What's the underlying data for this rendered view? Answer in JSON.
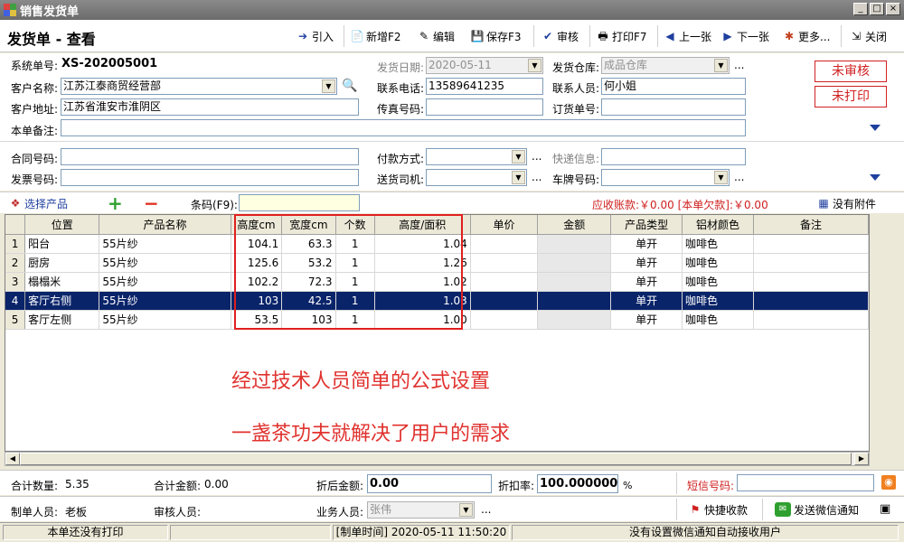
{
  "window": {
    "title": "销售发货单",
    "min": "_",
    "max": "□",
    "close": "×"
  },
  "toolbar": {
    "page_title": "发货单 - 查看",
    "import": "引入",
    "new": "新增F2",
    "edit": "编辑",
    "save": "保存F3",
    "audit": "审核",
    "print": "打印F7",
    "prev": "上一张",
    "next": "下一张",
    "more": "更多...",
    "close": "关闭"
  },
  "form": {
    "sys_no_label": "系统单号:",
    "sys_no": "XS-202005001",
    "customer_label": "客户名称:",
    "customer": "江苏江泰商贸经营部",
    "address_label": "客户地址:",
    "address": "江苏省淮安市淮阴区",
    "remark_label": "本单备注:",
    "remark": "",
    "date_label": "发货日期:",
    "date": "2020-05-11",
    "phone_label": "联系电话:",
    "phone": "13589641235",
    "fax_label": "传真号码:",
    "fax": "",
    "warehouse_label": "发货仓库:",
    "warehouse": "成品仓库",
    "contact_label": "联系人员:",
    "contact": "何小姐",
    "order_no_label": "订货单号:",
    "order_no": "",
    "contract_label": "合同号码:",
    "contract": "",
    "invoice_label": "发票号码:",
    "invoice": "",
    "payment_label": "付款方式:",
    "payment": "",
    "driver_label": "送货司机:",
    "driver": "",
    "express_label": "快递信息:",
    "express": "",
    "plate_label": "车牌号码:",
    "plate": "",
    "dots": "..."
  },
  "stamps": {
    "audit": "未审核",
    "print": "未打印"
  },
  "product_bar": {
    "select_product": "选择产品",
    "add": "+",
    "remove": "−",
    "barcode_label": "条码(F9):",
    "barcode": "",
    "receivable": "应收账款:￥0.00 [本单欠款]:￥0.00",
    "attachments": "没有附件"
  },
  "grid": {
    "headers": [
      "",
      "位置",
      "产品名称",
      "高度cm",
      "宽度cm",
      "个数",
      "高度/面积",
      "单价",
      "金额",
      "产品类型",
      "铝材颜色",
      "备注"
    ],
    "rows": [
      [
        "1",
        "阳台",
        "55片纱",
        "104.1",
        "63.3",
        "1",
        "1.04",
        "",
        "",
        "单开",
        "咖啡色",
        ""
      ],
      [
        "2",
        "厨房",
        "55片纱",
        "125.6",
        "53.2",
        "1",
        "1.26",
        "",
        "",
        "单开",
        "咖啡色",
        ""
      ],
      [
        "3",
        "榻榻米",
        "55片纱",
        "102.2",
        "72.3",
        "1",
        "1.02",
        "",
        "",
        "单开",
        "咖啡色",
        ""
      ],
      [
        "4",
        "客厅右侧",
        "55片纱",
        "103",
        "42.5",
        "1",
        "1.03",
        "",
        "",
        "单开",
        "咖啡色",
        ""
      ],
      [
        "5",
        "客厅左侧",
        "55片纱",
        "53.5",
        "103",
        "1",
        "1.00",
        "",
        "",
        "单开",
        "咖啡色",
        ""
      ]
    ],
    "selected_row": 3
  },
  "overlay": {
    "line1": "经过技术人员简单的公式设置",
    "line2": "一盏茶功夫就解决了用户的需求"
  },
  "summary": {
    "qty_label": "合计数量:",
    "qty": "5.35",
    "amount_label": "合计金额:",
    "amount": "0.00",
    "discount_amount_label": "折后金额:",
    "discount_amount": "0.00",
    "discount_rate_label": "折扣率:",
    "discount_rate": "100.000000",
    "percent": "%",
    "sms_label": "短信号码:",
    "sms": ""
  },
  "operators": {
    "maker_label": "制单人员:",
    "maker": "老板",
    "auditor_label": "审核人员:",
    "auditor": "",
    "salesman_label": "业务人员:",
    "salesman": "张伟",
    "quick_collect": "快捷收款",
    "wechat_notify": "发送微信通知"
  },
  "status": {
    "print_status": "本单还没有打印",
    "made_time": "[制单时间] 2020-05-11  11:50:20",
    "wechat_status": "没有设置微信通知自动接收用户"
  },
  "colors": {
    "accent_red": "#e0322e",
    "selection": "#0a246a",
    "link_blue": "#1f3f9f"
  }
}
